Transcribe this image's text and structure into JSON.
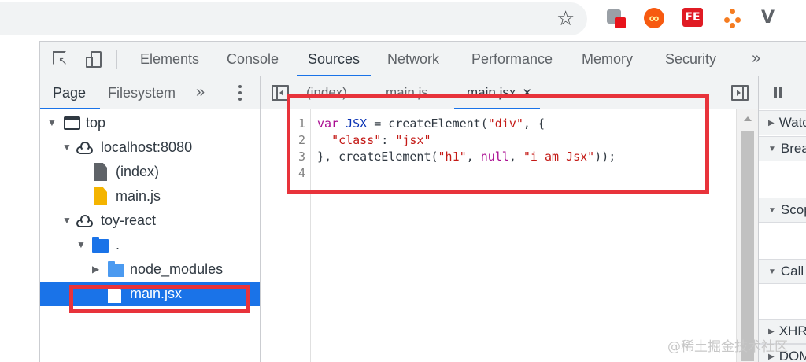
{
  "browser": {
    "star_glyph": "☆",
    "extensions": [
      {
        "name": "puzzle-extension-icon"
      },
      {
        "name": "infinity-extension-icon",
        "glyph": "∞"
      },
      {
        "name": "fe-extension-icon",
        "label": "FE"
      },
      {
        "name": "tree-extension-icon"
      },
      {
        "name": "v-extension-icon",
        "label": "V"
      }
    ]
  },
  "devtools": {
    "main_tabs": [
      "Elements",
      "Console",
      "Sources",
      "Network",
      "Performance",
      "Memory",
      "Security"
    ],
    "active_main_tab": "Sources",
    "more_glyph": "»"
  },
  "navigator": {
    "tabs": [
      "Page",
      "Filesystem"
    ],
    "more_glyph": "»",
    "tree": [
      {
        "label": "top",
        "icon": "frame-icon",
        "expanded": true
      },
      {
        "label": "localhost:8080",
        "icon": "cloud-icon",
        "expanded": true
      },
      {
        "label": "(index)",
        "icon": "document-icon"
      },
      {
        "label": "main.js",
        "icon": "js-file-icon"
      },
      {
        "label": "toy-react",
        "icon": "cloud-icon",
        "expanded": true
      },
      {
        "label": ".",
        "icon": "folder-icon",
        "expanded": true
      },
      {
        "label": "node_modules",
        "icon": "folder-icon",
        "expanded": false
      },
      {
        "label": "main.jsx",
        "icon": "jsx-file-icon",
        "selected": true
      }
    ]
  },
  "editor": {
    "tabs": [
      "(index)",
      "main.js",
      "main.jsx"
    ],
    "active_tab": "main.jsx",
    "close_glyph": "✕",
    "line_numbers": [
      "1",
      "2",
      "3",
      "4"
    ],
    "code_lines": [
      "var JSX = createElement(\"div\", {",
      "  \"class\": \"jsx\"",
      "}, createElement(\"h1\", null, \"i am Jsx\"));",
      ""
    ]
  },
  "sidebar": {
    "sections": [
      "Watch",
      "Breakpoints",
      "Scope",
      "Call Stack",
      "XHR/fetch Breakpoints",
      "DOM Breakpoints"
    ]
  },
  "watermark": "@稀土掘金技术社区",
  "colors": {
    "accent": "#1a73e8",
    "highlight_box": "#e8333b",
    "keyword": "#aa0d91",
    "string": "#c41a16",
    "variable": "#0a33b4"
  }
}
